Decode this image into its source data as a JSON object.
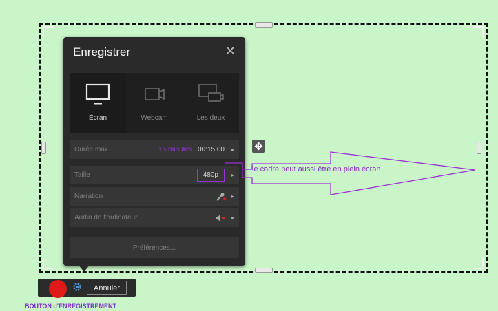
{
  "panel": {
    "title": "Enregistrer",
    "close_glyph": "✕",
    "modes": [
      {
        "label": "Écran",
        "icon": "monitor-icon",
        "active": true
      },
      {
        "label": "Webcam",
        "icon": "webcam-icon",
        "active": false
      },
      {
        "label": "Les deux",
        "icon": "both-screens-icon",
        "active": false
      }
    ],
    "rows": {
      "duration": {
        "label": "Durée max",
        "note": "15 minutes",
        "value": "00:15:00"
      },
      "size": {
        "label": "Taille",
        "value": "480p"
      },
      "narration": {
        "label": "Narration"
      },
      "audio": {
        "label": "Audio de l'ordinateur"
      }
    },
    "preferences_label": "Préférences...",
    "arrow_glyph": "▸"
  },
  "callout_text": "le cadre peut aussi être en plein écran",
  "recorder": {
    "cancel_label": "Annuler",
    "caption": "BOUTON d'ENREGISTREMENT"
  },
  "colors": {
    "background": "#c9f5c9",
    "annotation": "#9b32d6",
    "record": "#e01919",
    "panel": "#2a2a2a"
  }
}
